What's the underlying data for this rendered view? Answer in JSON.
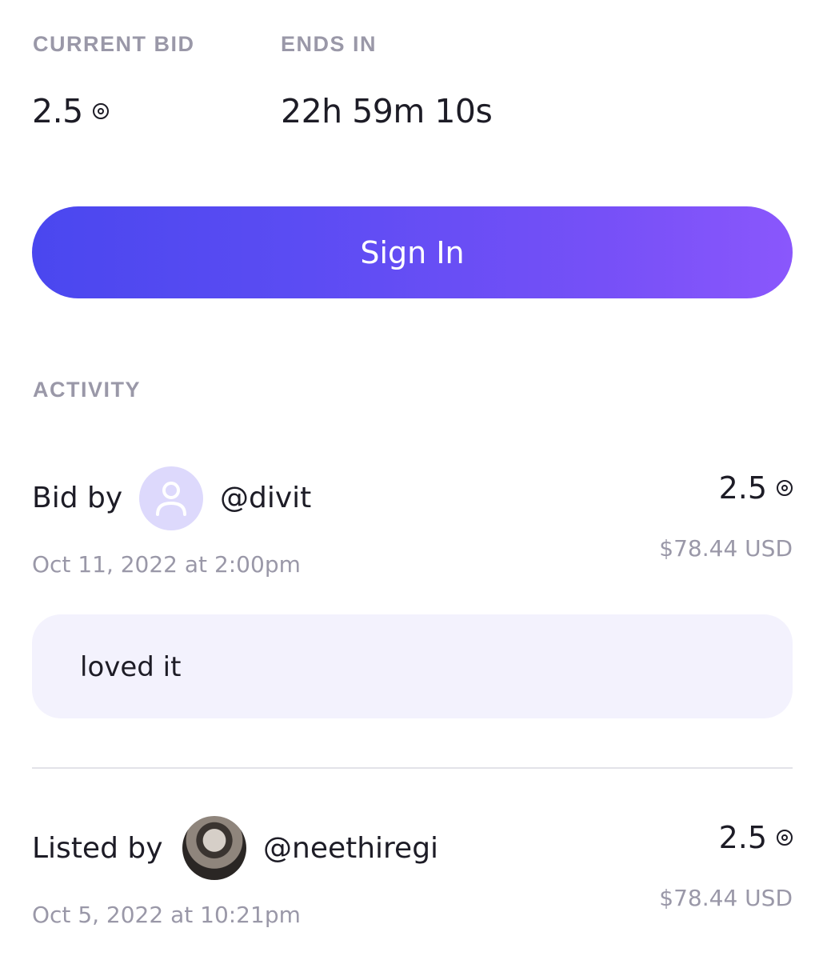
{
  "auction": {
    "current_bid_label": "CURRENT BID",
    "current_bid_value": "2.5",
    "ends_in_label": "ENDS IN",
    "ends_in_value": "22h 59m 10s"
  },
  "signin_button": {
    "label": "Sign In"
  },
  "activity": {
    "title": "ACTIVITY",
    "items": [
      {
        "action": "Bid by",
        "handle": "@divit",
        "avatar": "user-placeholder-icon",
        "date": "Oct 11, 2022 at 2:00pm",
        "amount": "2.5",
        "usd": "$78.44 USD",
        "comment": "loved it"
      },
      {
        "action": "Listed by",
        "handle": "@neethiregi",
        "avatar": "profile-photo",
        "date": "Oct 5, 2022 at 10:21pm",
        "amount": "2.5",
        "usd": "$78.44 USD"
      }
    ]
  },
  "colors": {
    "accent_start": "#4a47ef",
    "accent_end": "#8a57fc",
    "muted_text": "#9a98a8",
    "comment_bg": "#f3f2fd",
    "avatar_bg": "#ddd9fc"
  },
  "icons": {
    "currency": "currency-coin-icon"
  }
}
